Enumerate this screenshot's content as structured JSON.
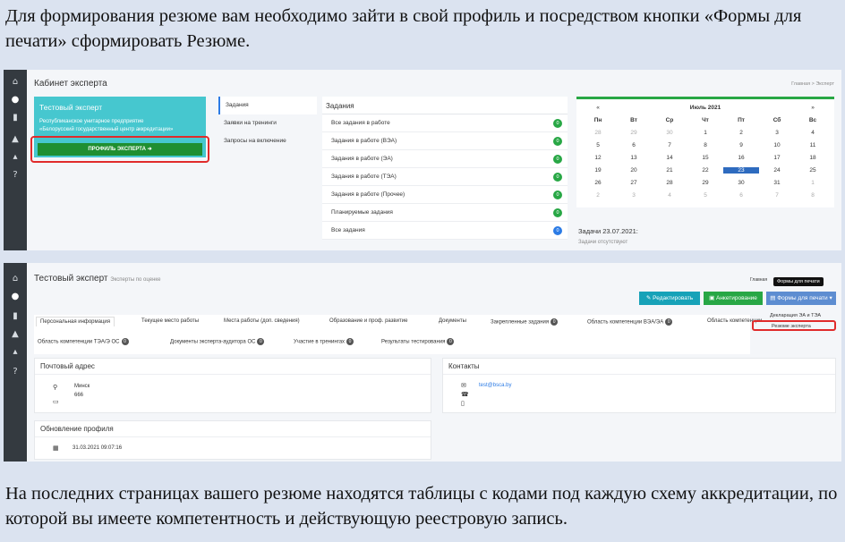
{
  "text": {
    "top": "Для формирования резюме вам необходимо зайти в свой профиль и посредством кнопки «Формы для печати» сформировать Резюме.",
    "bottom": "На последних страницах вашего резюме находятся таблицы с кодами под каждую схему аккредитации, по которой вы имеете компетентность и действующую реестровую запись."
  },
  "panel1": {
    "title": "Кабинет эксперта",
    "breadcrumb": "Главная > Эксперт",
    "card_name": "Тестовый эксперт",
    "org_line1": "Республиканское унитарное предприятие",
    "org_line2": "«Белорусский государственный центр аккредитации»",
    "profile_button": "ПРОФИЛЬ ЭКСПЕРТА ➜",
    "menu": [
      "Задания",
      "Заявки на тренинги",
      "Запросы на включение"
    ],
    "tasks_header": "Задания",
    "tasks": [
      {
        "label": "Все задания в работе",
        "count": "0"
      },
      {
        "label": "Задания в работе (ВЭА)",
        "count": "0"
      },
      {
        "label": "Задания в работе (ЭА)",
        "count": "0"
      },
      {
        "label": "Задания в работе (ТЭА)",
        "count": "0"
      },
      {
        "label": "Задания в работе (Прочее)",
        "count": "0"
      },
      {
        "label": "Планируемые задания",
        "count": "0"
      },
      {
        "label": "Все задания",
        "count": "0"
      }
    ],
    "calendar": {
      "month": "Июль 2021",
      "prev": "«",
      "next": "»",
      "weekdays": [
        "Пн",
        "Вт",
        "Ср",
        "Чт",
        "Пт",
        "Сб",
        "Вс"
      ],
      "weeks": [
        [
          "28",
          "29",
          "30",
          "1",
          "2",
          "3",
          "4"
        ],
        [
          "5",
          "6",
          "7",
          "8",
          "9",
          "10",
          "11"
        ],
        [
          "12",
          "13",
          "14",
          "15",
          "16",
          "17",
          "18"
        ],
        [
          "19",
          "20",
          "21",
          "22",
          "23",
          "24",
          "25"
        ],
        [
          "26",
          "27",
          "28",
          "29",
          "30",
          "31",
          "1"
        ],
        [
          "2",
          "3",
          "4",
          "5",
          "6",
          "7",
          "8"
        ]
      ]
    },
    "tasks_date": "Задачи 23.07.2021:",
    "tasks_empty": "Задачи отсутствуют"
  },
  "panel2": {
    "title": "Тестовый эксперт",
    "subtitle": "Эксперты по оценке",
    "breadcrumb": "Главная",
    "tooltip": "Формы для печати",
    "btn_edit": "✎ Редактировать",
    "btn_survey": "▣ Анкетирование",
    "btn_forms": "▤ Формы для печати ▾",
    "dropdown_item1": "Декларация ЭА и ТЭА",
    "dropdown_item2": "Резюме эксперта",
    "tabs_row1": [
      "Персональная информация",
      "Текущее место работы",
      "Места работы (доп. сведения)",
      "Образование и проф. развитие",
      "Документы",
      "Закрепленные задания",
      "Область компетенции ВЭА/ЭА",
      "Область компетенции"
    ],
    "tabs_row2": [
      "Область компетенции ТЭА/Э ОС",
      "Документы эксперта-аудитора ОС",
      "Участие в тренингах",
      "Результаты тестирования"
    ],
    "postal_header": "Почтовый адрес",
    "city": "Минск",
    "code": "666",
    "contacts_header": "Контакты",
    "email": "test@bsca.by",
    "update_header": "Обновление профиля",
    "update_date": "31.03.2021 09:07:16"
  }
}
